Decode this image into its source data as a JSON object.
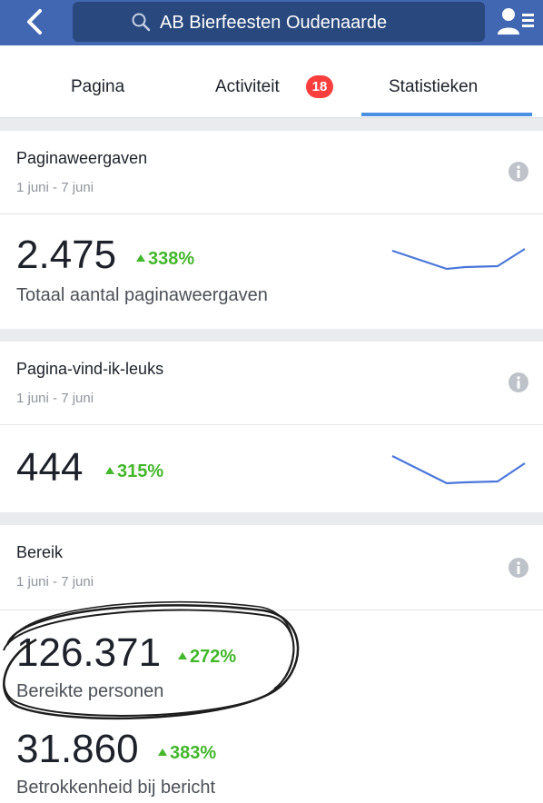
{
  "header": {
    "search_text": "AB Bierfeesten Oudenaarde",
    "back_icon": "back-chevron-icon",
    "profile_icon": "profile-menu-icon",
    "bar_color": "#4267b2"
  },
  "tabs": [
    {
      "label": "Pagina"
    },
    {
      "label": "Activiteit",
      "badge": "18"
    },
    {
      "label": "Statistieken",
      "active": true
    }
  ],
  "cards": [
    {
      "title": "Paginaweergaven",
      "date_range": "1 juni - 7 juni",
      "value": "2.475",
      "change": "338%",
      "label": "Totaal aantal paginaweergaven"
    },
    {
      "title": "Pagina-vind-ik-leuks",
      "date_range": "1 juni - 7 juni",
      "value": "444",
      "change": "315%"
    },
    {
      "title": "Bereik",
      "date_range": "1 juni - 7 juni",
      "metrics": [
        {
          "value": "126.371",
          "change": "272%",
          "label": "Bereikte personen"
        },
        {
          "value": "31.860",
          "change": "383%",
          "label": "Betrokkenheid bij bericht"
        }
      ]
    }
  ],
  "colors": {
    "accent": "#4a90e2",
    "positive": "#42b72a",
    "badge": "#fa3e3e"
  }
}
